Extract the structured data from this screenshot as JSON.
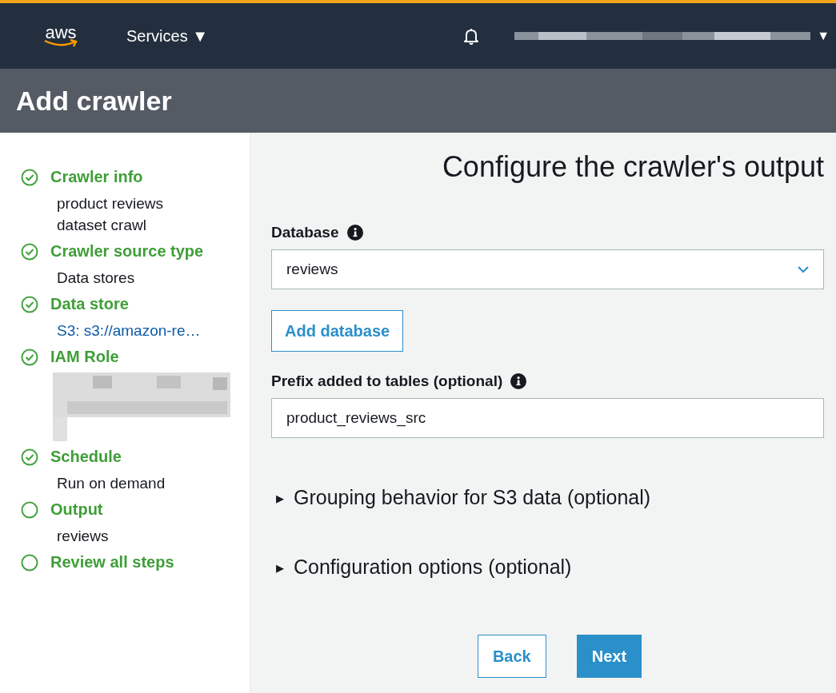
{
  "top_bar": {
    "logo": "aws",
    "services_menu": {
      "label": "Services",
      "caret": "▼"
    },
    "account_caret": "▼"
  },
  "page_title": "Add crawler",
  "steps": [
    {
      "title": "Crawler info",
      "completed": true,
      "details": [
        {
          "kind": "text",
          "text": "product reviews dataset crawl"
        }
      ]
    },
    {
      "title": "Crawler source type",
      "completed": true,
      "details": [
        {
          "kind": "text",
          "text": "Data stores"
        }
      ]
    },
    {
      "title": "Data store",
      "completed": true,
      "details": [
        {
          "kind": "link",
          "text": "S3: s3://amazon-re…"
        }
      ]
    },
    {
      "title": "IAM Role",
      "completed": true,
      "details": [
        {
          "kind": "redacted"
        }
      ]
    },
    {
      "title": "Schedule",
      "completed": true,
      "details": [
        {
          "kind": "text",
          "text": "Run on demand"
        }
      ]
    },
    {
      "title": "Output",
      "completed": false,
      "details": [
        {
          "kind": "text",
          "text": "reviews"
        }
      ]
    },
    {
      "title": "Review all steps",
      "completed": false
    }
  ],
  "form": {
    "heading": "Configure the crawler's output",
    "database": {
      "label": "Database",
      "value": "reviews"
    },
    "add_database_button": "Add database",
    "prefix": {
      "label": "Prefix added to tables (optional)",
      "value": "product_reviews_src"
    },
    "sections": [
      {
        "caret": "▸",
        "label": "Grouping behavior for S3 data (optional)",
        "expanded": false
      },
      {
        "caret": "▸",
        "label": "Configuration options (optional)",
        "expanded": false
      }
    ],
    "buttons": [
      {
        "kind": "secondary",
        "label": "Back"
      },
      {
        "kind": "primary",
        "label": "Next"
      }
    ]
  }
}
